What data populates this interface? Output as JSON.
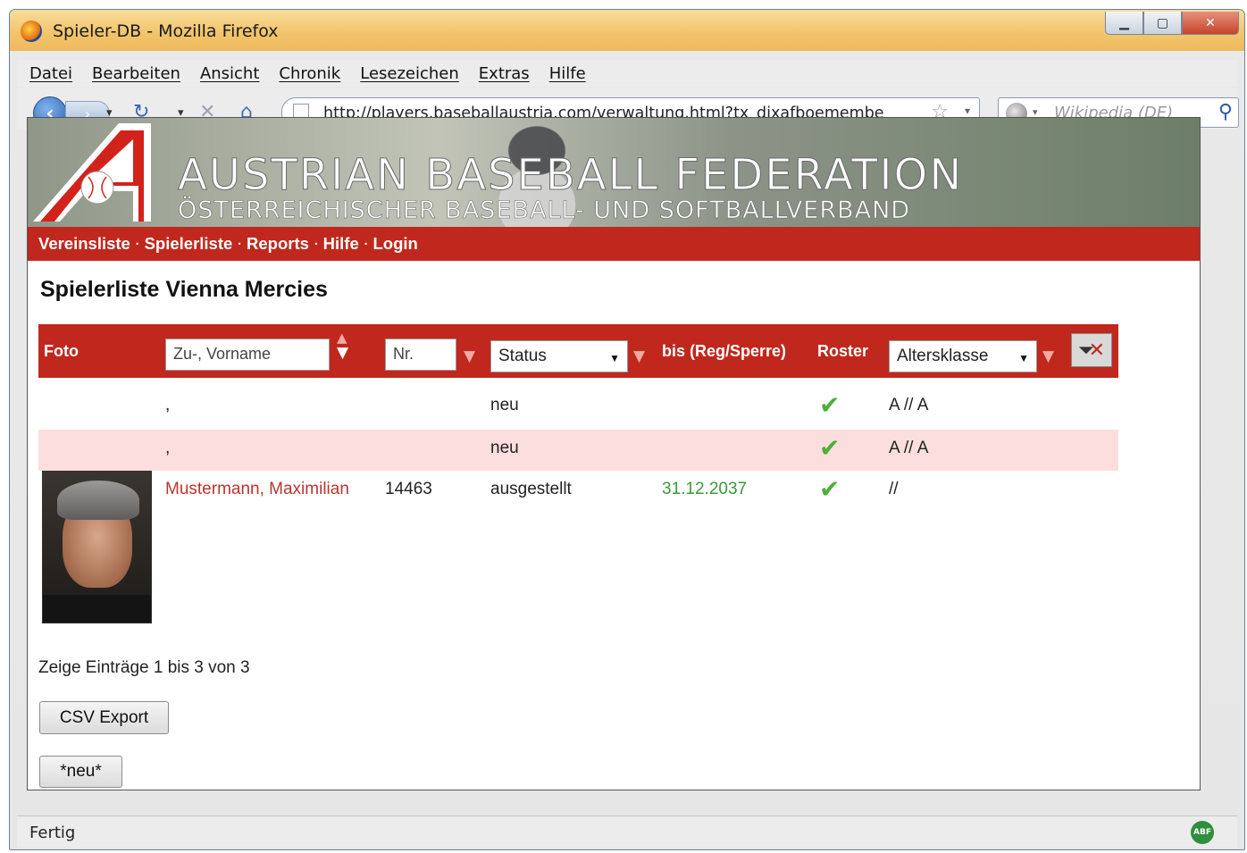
{
  "window": {
    "title": "Spieler-DB - Mozilla Firefox"
  },
  "menu": [
    "Datei",
    "Bearbeiten",
    "Ansicht",
    "Chronik",
    "Lesezeichen",
    "Extras",
    "Hilfe"
  ],
  "nav": {
    "url": "http://players.baseballaustria.com/verwaltung.html?tx_dixafboemembe",
    "search_placeholder": "Wikipedia (DE)"
  },
  "banner": {
    "title": "AUSTRIAN BASEBALL FEDERATION",
    "subtitle": "ÖSTERREICHISCHER BASEBALL- UND SOFTBALLVERBAND"
  },
  "site_nav": [
    "Vereinsliste",
    "Spielerliste",
    "Reports",
    "Hilfe",
    "Login"
  ],
  "page": {
    "title": "Spielerliste Vienna Mercies"
  },
  "table": {
    "header": {
      "foto": "Foto",
      "name_filter": "Zu-, Vorname",
      "nr_filter": "Nr.",
      "status_select": "Status",
      "bis": "bis (Reg/Sperre)",
      "roster": "Roster",
      "altersklasse_select": "Altersklasse"
    },
    "rows": [
      {
        "name": ",",
        "nr": "",
        "status": "neu",
        "bis": "",
        "roster": true,
        "klasse": "A // A"
      },
      {
        "name": ",",
        "nr": "",
        "status": "neu",
        "bis": "",
        "roster": true,
        "klasse": "A // A"
      },
      {
        "name": "Mustermann, Maximilian",
        "nr": "14463",
        "status": "ausgestellt",
        "bis": "31.12.2037",
        "roster": true,
        "klasse": "//"
      }
    ]
  },
  "summary": "Zeige Einträge 1 bis 3 von 3",
  "buttons": {
    "csv": "CSV Export",
    "neu": "*neu*"
  },
  "status_bar": {
    "text": "Fertig",
    "addon_badge": "ABF"
  },
  "colors": {
    "accent_red": "#c0281d",
    "alt_row": "#fbdedd",
    "link": "#b8362d",
    "date_green": "#3a9a3a",
    "check_green": "#4cb03a"
  }
}
